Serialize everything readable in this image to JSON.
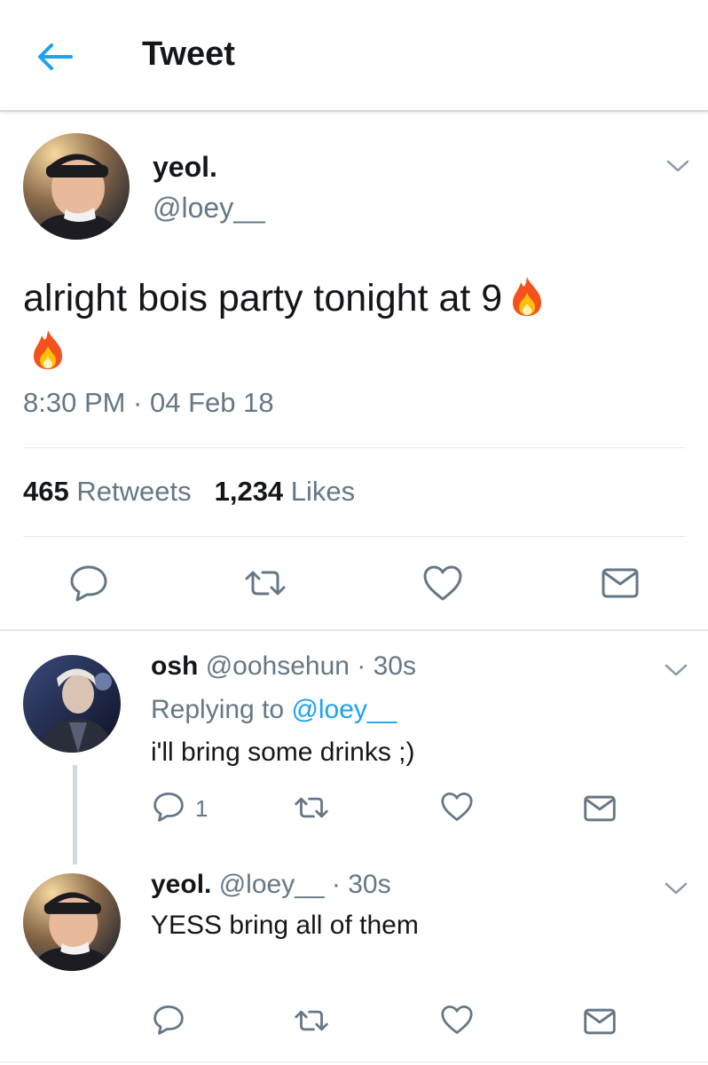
{
  "header": {
    "title": "Tweet"
  },
  "main_tweet": {
    "name": "yeol.",
    "handle": "@loey__",
    "text_line1": "alright bois party tonight at 9",
    "timestamp": "8:30 PM · 04 Feb 18",
    "retweets_count": "465",
    "retweets_label": "Retweets",
    "likes_count": "1,234",
    "likes_label": "Likes"
  },
  "replies": [
    {
      "name": "osh",
      "handle": "@oohsehun",
      "time": "· 30s",
      "replying_label": "Replying to",
      "replying_to": "@loey__",
      "text": "i'll bring some drinks ;)",
      "reply_count": "1"
    },
    {
      "name": "yeol.",
      "handle": "@loey__",
      "time": "· 30s",
      "text": "YESS bring all of them"
    }
  ],
  "colors": {
    "accent": "#1da1f2",
    "text": "#14171a",
    "muted": "#657786",
    "icon": "#657786",
    "flame": "#f4511e"
  }
}
